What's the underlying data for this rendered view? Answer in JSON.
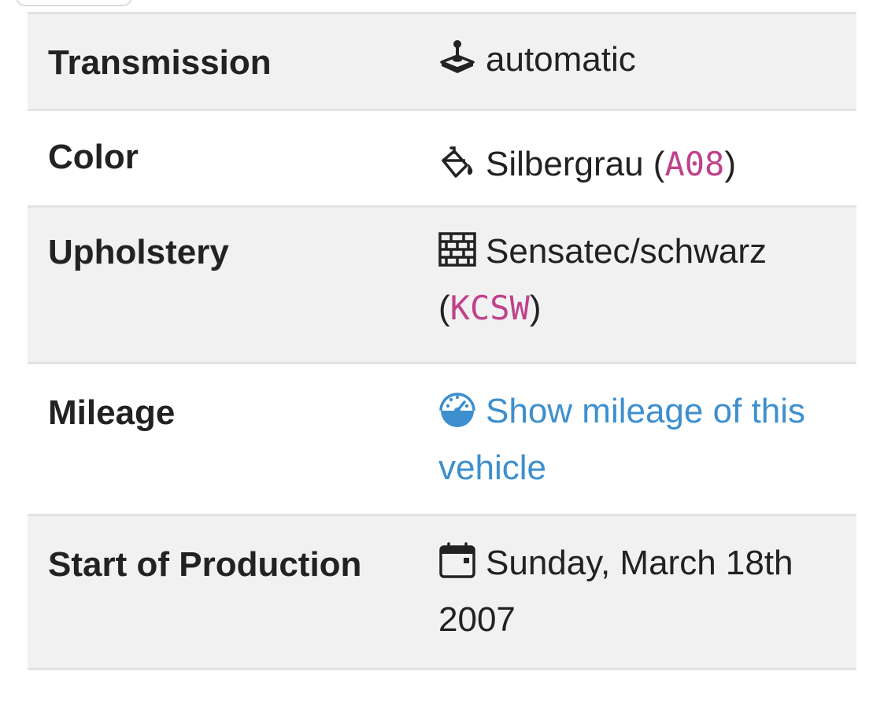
{
  "specs": {
    "transmission": {
      "label": "Transmission",
      "icon": "joystick-icon",
      "value": "automatic"
    },
    "color": {
      "label": "Color",
      "icon": "paint-bucket-icon",
      "value": "Silbergrau",
      "code": "A08"
    },
    "upholstery": {
      "label": "Upholstery",
      "icon": "brick-wall-icon",
      "value": "Sensatec/schwarz",
      "code": "KCSW"
    },
    "mileage": {
      "label": "Mileage",
      "icon": "speedometer-icon",
      "link_text": "Show mileage of this vehicle"
    },
    "production": {
      "label": "Start of Production",
      "icon": "calendar-icon",
      "value": "Sunday, March 18th 2007"
    }
  },
  "colors": {
    "row_shade": "#f1f1f1",
    "divider": "#e3e3e3",
    "code": "#c0418b",
    "link": "#3d8fce",
    "text": "#222222"
  }
}
